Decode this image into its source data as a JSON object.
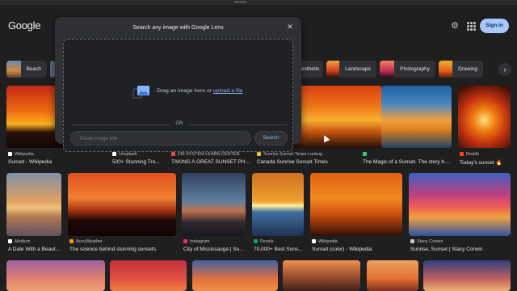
{
  "browser": {
    "url": "sunset"
  },
  "header": {
    "logo": "Google",
    "signin_label": "Sign in",
    "settings_icon": "gear-icon",
    "apps_icon": "apps-grid-icon"
  },
  "chips": [
    {
      "label": "Beach",
      "thumb": "#c87a3a"
    },
    {
      "label": "esthetic",
      "thumb": "#7a3a6a"
    },
    {
      "label": "Landscape",
      "thumb": "#e0602a"
    },
    {
      "label": "Photography",
      "thumb": "#d9504a"
    },
    {
      "label": "Drawing",
      "thumb": "#e08a2a"
    }
  ],
  "lens": {
    "title": "Search any image with Google Lens",
    "drop_text": "Drag an image here or",
    "upload_link": "upload a file",
    "or_text": "OR",
    "paste_placeholder": "Paste image link",
    "search_label": "Search"
  },
  "results_row1": [
    {
      "source": "Wikipedia",
      "title": "Sunset - Wikipedia",
      "fav": "#ffffff"
    },
    {
      "source": "Unsplash",
      "title": "500+ Stunning Tro...",
      "fav": "#ffffff"
    },
    {
      "source": "CM SYSTEM LEARN CENTER",
      "title": "TAKING A GREAT SUNSET PH...",
      "fav": "#e74c3c"
    },
    {
      "source": "Sunrise Sunset Times Lookup",
      "title": "Canada Sunrise Sunset Times",
      "fav": "#f1c40f"
    },
    {
      "source": "",
      "title": "The Magic of a Sunset. The story be...",
      "fav": "#2ecc71"
    },
    {
      "source": "Reddit",
      "title": "Today's sunset 🔥",
      "fav": "#ff4500"
    }
  ],
  "results_row2": [
    {
      "source": "Medium",
      "title": "A Date With a Beaut...",
      "fav": "#ffffff"
    },
    {
      "source": "AccuWeather",
      "title": "The science behind stunning sunsets",
      "fav": "#f39c12"
    },
    {
      "source": "Instagram",
      "title": "City of Mississauga | Su...",
      "fav": "#e1306c"
    },
    {
      "source": "Pexels",
      "title": "70,000+ Best Suns...",
      "fav": "#05a081"
    },
    {
      "source": "Wikipedia",
      "title": "Sunset (color) - Wikipedia",
      "fav": "#ffffff"
    },
    {
      "source": "Stacy Corwin",
      "title": "Sunrise, Sunset | Stacy Corwin",
      "fav": "#cccccc"
    }
  ]
}
